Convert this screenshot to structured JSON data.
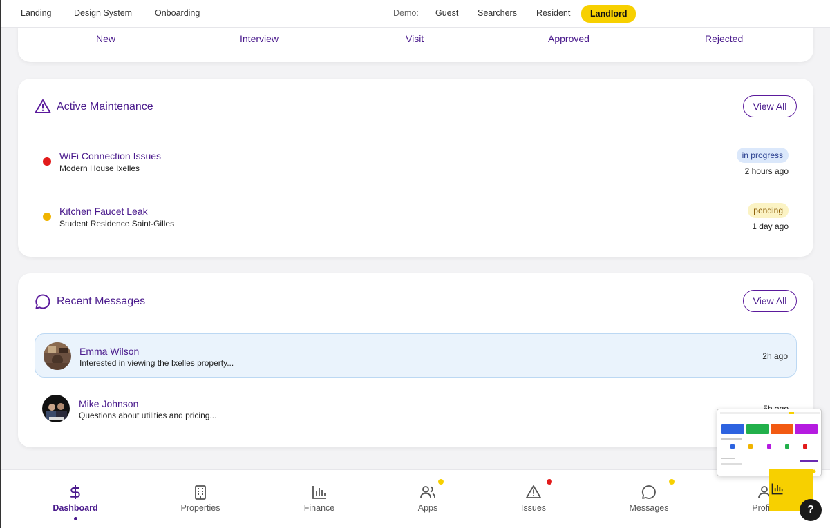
{
  "topnav": {
    "links": [
      "Landing",
      "Design System",
      "Onboarding"
    ],
    "demo_label": "Demo:",
    "demo_options": [
      "Guest",
      "Searchers",
      "Resident",
      "Landlord"
    ],
    "active_demo": "Landlord"
  },
  "pipeline": {
    "stages": [
      "New",
      "Interview",
      "Visit",
      "Approved",
      "Rejected"
    ]
  },
  "maintenance": {
    "title": "Active Maintenance",
    "view_all": "View All",
    "items": [
      {
        "title": "WiFi Connection Issues",
        "property": "Modern House Ixelles",
        "status": "in progress",
        "time": "2 hours ago",
        "dot_color": "#e21b1b",
        "badge_bg": "#dbe8fb",
        "badge_fg": "#2a3f8f"
      },
      {
        "title": "Kitchen Faucet Leak",
        "property": "Student Residence Saint-Gilles",
        "status": "pending",
        "time": "1 day ago",
        "dot_color": "#f0b400",
        "badge_bg": "#fbf3c4",
        "badge_fg": "#8a5a00"
      }
    ]
  },
  "messages": {
    "title": "Recent Messages",
    "view_all": "View All",
    "items": [
      {
        "name": "Emma Wilson",
        "text": "Interested in viewing the Ixelles property...",
        "time": "2h ago"
      },
      {
        "name": "Mike Johnson",
        "text": "Questions about utilities and pricing...",
        "time": "5h ago"
      }
    ]
  },
  "bottomnav": {
    "tabs": [
      {
        "label": "Dashboard",
        "icon": "dollar-icon"
      },
      {
        "label": "Properties",
        "icon": "building-icon"
      },
      {
        "label": "Finance",
        "icon": "bar-chart-icon"
      },
      {
        "label": "Apps",
        "icon": "users-icon"
      },
      {
        "label": "Issues",
        "icon": "warning-icon"
      },
      {
        "label": "Messages",
        "icon": "chat-icon"
      },
      {
        "label": "Profile",
        "icon": "user-icon"
      }
    ],
    "active": "Dashboard"
  },
  "help_label": "?",
  "colors": {
    "brand": "#4a1a8c",
    "accent": "#f7d000"
  }
}
